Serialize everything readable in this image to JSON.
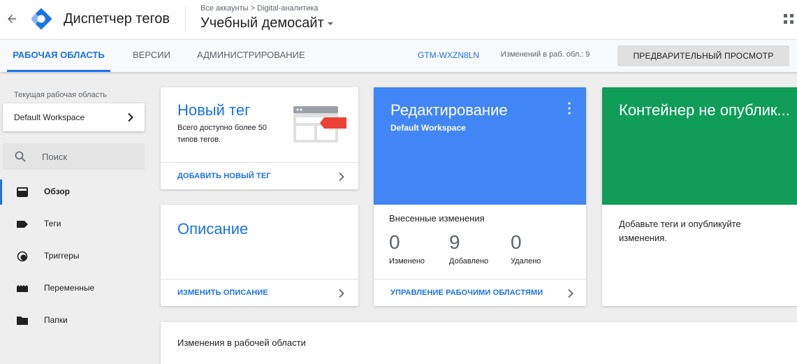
{
  "header": {
    "app_title": "Диспетчер тегов",
    "breadcrumb": "Все аккаунты > Digital-аналитика",
    "container_name": "Учебный демосайт"
  },
  "tabs": [
    {
      "label": "РАБОЧАЯ ОБЛАСТЬ",
      "active": true
    },
    {
      "label": "ВЕРСИИ",
      "active": false
    },
    {
      "label": "АДМИНИСТРИРОВАНИЕ",
      "active": false
    }
  ],
  "toolbar": {
    "container_id": "GTM-WXZN8LN",
    "workspace_changes": "Изменений в раб. обл.: 9",
    "preview_label": "ПРЕДВАРИТЕЛЬНЫЙ ПРОСМОТР"
  },
  "sidebar": {
    "workspace_label": "Текущая рабочая область",
    "workspace_name": "Default Workspace",
    "search_placeholder": "Поиск",
    "items": [
      {
        "label": "Обзор",
        "icon": "overview-icon",
        "active": true
      },
      {
        "label": "Теги",
        "icon": "tag-icon",
        "active": false
      },
      {
        "label": "Триггеры",
        "icon": "trigger-icon",
        "active": false
      },
      {
        "label": "Переменные",
        "icon": "variables-icon",
        "active": false
      },
      {
        "label": "Папки",
        "icon": "folder-icon",
        "active": false
      }
    ]
  },
  "cards": {
    "new_tag": {
      "title": "Новый тег",
      "description": "Всего доступно более 50 типов тегов.",
      "link": "ДОБАВИТЬ НОВЫЙ ТЕГ"
    },
    "description": {
      "title": "Описание",
      "link": "ИЗМЕНИТЬ ОПИСАНИЕ"
    },
    "editing": {
      "title": "Редактирование",
      "subtitle": "Default Workspace",
      "changes_title": "Внесенные изменения",
      "stats": [
        {
          "value": "0",
          "label": "Изменено"
        },
        {
          "value": "9",
          "label": "Добавлено"
        },
        {
          "value": "0",
          "label": "Удалено"
        }
      ],
      "link": "УПРАВЛЕНИЕ РАБОЧИМИ ОБЛАСТЯМИ"
    },
    "publish": {
      "title": "Контейнер не опублик...",
      "text": "Добавьте теги и опубликуйте изменения."
    },
    "workspace_changes": {
      "title": "Изменения в рабочей области"
    }
  },
  "colors": {
    "accent": "#1a73e8",
    "edit_card": "#4285f4",
    "publish_card": "#0f9d58",
    "new_tag_flag": "#ea4335"
  }
}
